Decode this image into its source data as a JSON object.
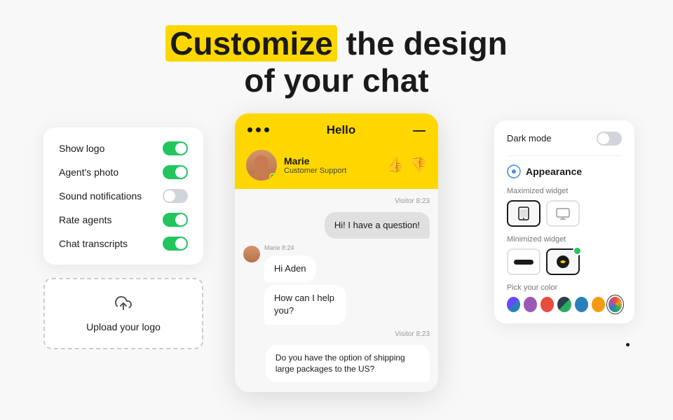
{
  "header": {
    "line1_plain": "the design",
    "line1_highlight": "Customize",
    "line2": "of your chat"
  },
  "left_panel": {
    "toggles": [
      {
        "label": "Show logo",
        "state": "on"
      },
      {
        "label": "Agent's photo",
        "state": "on"
      },
      {
        "label": "Sound notifications",
        "state": "off"
      },
      {
        "label": "Rate agents",
        "state": "on"
      },
      {
        "label": "Chat transcripts",
        "state": "on"
      }
    ],
    "upload_label": "Upload your  logo"
  },
  "chat_widget": {
    "header_title": "Hello",
    "agent_name": "Marie",
    "agent_role": "Customer Support",
    "messages": [
      {
        "type": "timestamp",
        "align": "right",
        "text": "Visitor 8:23"
      },
      {
        "type": "bubble",
        "side": "visitor",
        "text": "Hi! I have a question!"
      },
      {
        "type": "agent_meta",
        "text": "Marie 8:24"
      },
      {
        "type": "bubble",
        "side": "agent",
        "text": "Hi Aden"
      },
      {
        "type": "bubble",
        "side": "agent",
        "text": "How can I help you?"
      },
      {
        "type": "timestamp",
        "align": "right",
        "text": "Visitor 8:23"
      },
      {
        "type": "bubble",
        "side": "visitor_long",
        "text": "Do you have the option of shipping large packages to the US?"
      }
    ]
  },
  "right_panel": {
    "dark_mode_label": "Dark mode",
    "appearance_label": "Appearance",
    "maximized_label": "Maximized widget",
    "minimized_label": "Minimized widget",
    "color_label": "Pick your color",
    "colors": [
      "#6B48FF",
      "#9B59B6",
      "#E74C3C",
      "#27AE60",
      "#2980B9",
      "#F39C12",
      "#1ABC9C"
    ]
  }
}
